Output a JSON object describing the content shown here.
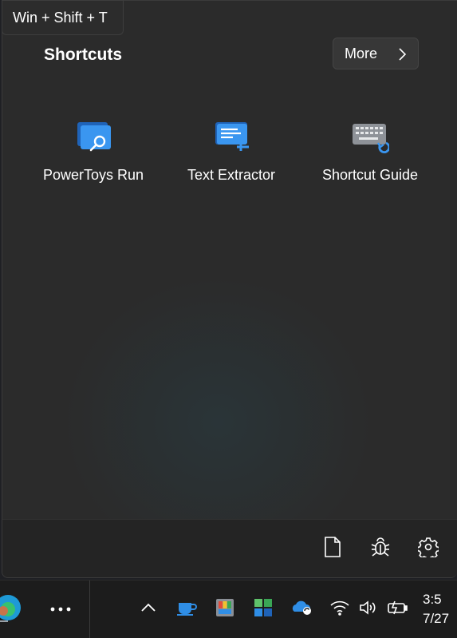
{
  "tooltip": {
    "text": "Win + Shift + T"
  },
  "flyout": {
    "title": "Shortcuts",
    "more_label": "More",
    "tools": [
      {
        "label": "PowerToys Run",
        "icon": "powertoys-run-icon"
      },
      {
        "label": "Text Extractor",
        "icon": "text-extractor-icon"
      },
      {
        "label": "Shortcut Guide",
        "icon": "shortcut-guide-icon"
      }
    ],
    "footer": [
      {
        "icon": "document-icon"
      },
      {
        "icon": "bug-icon"
      },
      {
        "icon": "gear-icon"
      }
    ]
  },
  "taskbar": {
    "clock_time": "3:5",
    "clock_date": "7/27",
    "items": [
      {
        "icon": "edge-icon"
      },
      {
        "icon": "more-dots-icon"
      },
      {
        "icon": "chevron-up-icon"
      },
      {
        "icon": "awake-cup-icon"
      },
      {
        "icon": "color-picker-icon"
      },
      {
        "icon": "powertoys-icon"
      },
      {
        "icon": "onedrive-icon"
      },
      {
        "icon": "wifi-icon"
      },
      {
        "icon": "volume-icon"
      },
      {
        "icon": "battery-icon"
      }
    ]
  },
  "colors": {
    "panel_bg": "#2b2b2b",
    "footer_bg": "#242424",
    "accent_blue": "#2f8ee6",
    "taskbar_bg": "#1c1c1c"
  }
}
